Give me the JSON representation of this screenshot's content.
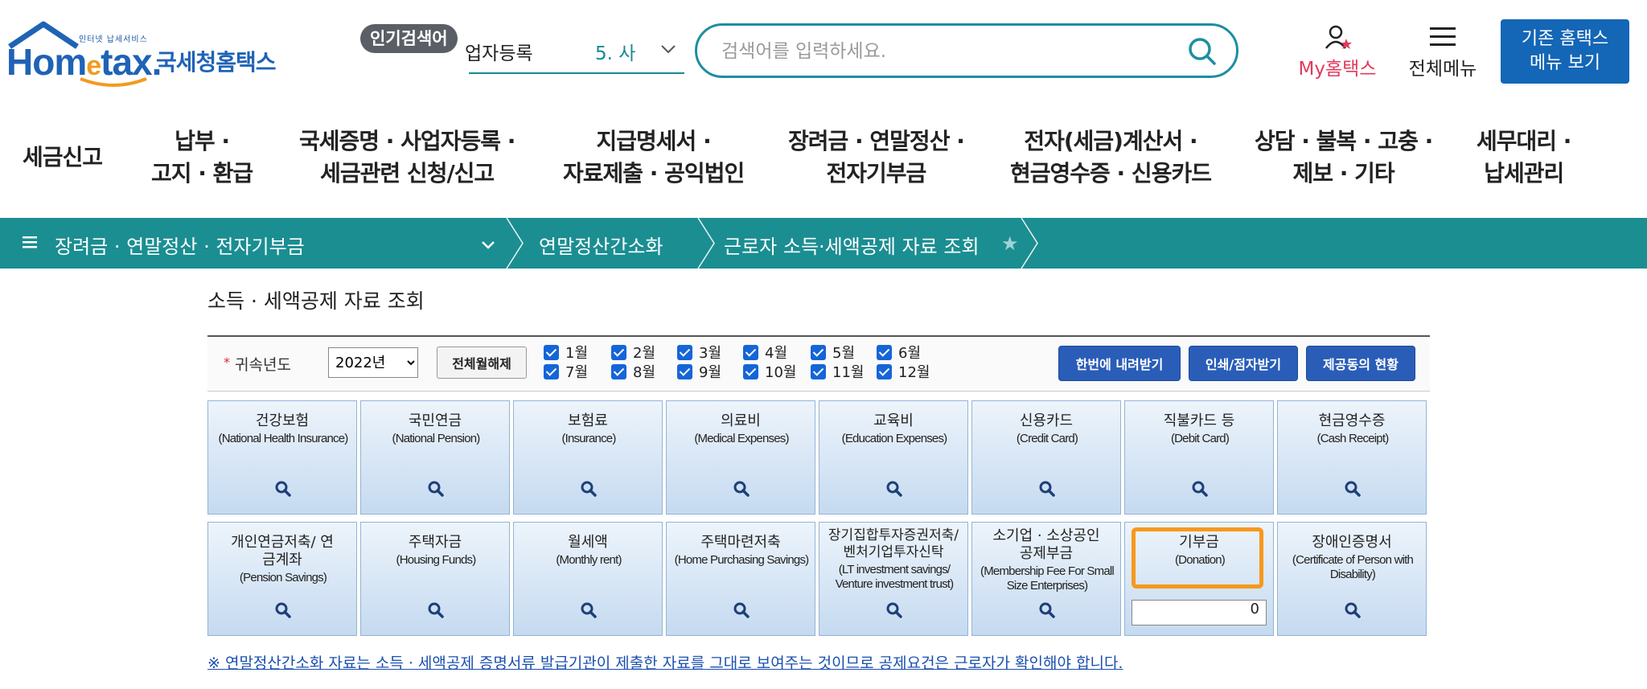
{
  "header": {
    "logo_small": "인터넷 납세서비스",
    "logo_word_a": "Hom",
    "logo_word_e": "e",
    "logo_word_b": "tax.",
    "logo_kr": "국세청홈택스",
    "popular_tag": "인기검색어",
    "popular_text": "업자등록",
    "popular_num": "5. 사",
    "search_placeholder": "검색어를 입력하세요.",
    "my_label": "My홈택스",
    "allmenu_label": "전체메뉴",
    "old_menu_line1": "기존 홈택스",
    "old_menu_line2": "메뉴 보기"
  },
  "gnb": [
    {
      "l1": "세금신고",
      "l2": ""
    },
    {
      "l1": "납부 ·",
      "l2": "고지 · 환급"
    },
    {
      "l1": "국세증명 · 사업자등록 ·",
      "l2": "세금관련 신청/신고"
    },
    {
      "l1": "지급명세서 ·",
      "l2": "자료제출 · 공익법인"
    },
    {
      "l1": "장려금 · 연말정산 ·",
      "l2": "전자기부금"
    },
    {
      "l1": "전자(세금)계산서 ·",
      "l2": "현금영수증 · 신용카드"
    },
    {
      "l1": "상담 · 불복 · 고충 ·",
      "l2": "제보 · 기타"
    },
    {
      "l1": "세무대리 ·",
      "l2": "납세관리"
    }
  ],
  "breadcrumb": {
    "level1": "장려금 · 연말정산 · 전자기부금",
    "level2": "연말정산간소화",
    "level3": "근로자 소득·세액공제 자료 조회"
  },
  "page_title": "소득 · 세액공제 자료 조회",
  "filter": {
    "year_label": "귀속년도",
    "year_value": "2022년",
    "uncheck_all": "전체월해제",
    "months": [
      "1월",
      "2월",
      "3월",
      "4월",
      "5월",
      "6월",
      "7월",
      "8월",
      "9월",
      "10월",
      "11월",
      "12월"
    ],
    "btn_download": "한번에 내려받기",
    "btn_print": "인쇄/점자받기",
    "btn_status": "제공동의 현황"
  },
  "tiles": [
    {
      "kr": "건강보험",
      "en": "(National Health Insurance)"
    },
    {
      "kr": "국민연금",
      "en": "(National Pension)"
    },
    {
      "kr": "보험료",
      "en": "(Insurance)"
    },
    {
      "kr": "의료비",
      "en": "(Medical Expenses)"
    },
    {
      "kr": "교육비",
      "en": "(Education Expenses)"
    },
    {
      "kr": "신용카드",
      "en": "(Credit Card)"
    },
    {
      "kr": "직불카드 등",
      "en": "(Debit Card)"
    },
    {
      "kr": "현금영수증",
      "en": "(Cash Receipt)"
    },
    {
      "kr": "개인연금저축/ 연금계좌",
      "en": "(Pension Savings)"
    },
    {
      "kr": "주택자금",
      "en": "(Housing Funds)"
    },
    {
      "kr": "월세액",
      "en": "(Monthly rent)"
    },
    {
      "kr": "주택마련저축",
      "en": "(Home Purchasing Savings)"
    },
    {
      "kr": "장기집합투자증권저축/ 벤처기업투자신탁",
      "en": "(LT investment savings/ Venture investment trust)"
    },
    {
      "kr": "소기업 · 소상공인 공제부금",
      "en": "(Membership Fee For Small Size Enterprises)"
    },
    {
      "kr": "기부금",
      "en": "(Donation)",
      "amount": "0"
    },
    {
      "kr": "장애인증명서",
      "en": "(Certificate of Person with Disability)"
    }
  ],
  "notice": "※ 연말정산간소화 자료는 소득 · 세액공제 증명서류 발급기관이 제출한 자료를 그대로 보여주는 것이므로 공제요건은 근로자가 확인해야 합니다.",
  "colors": {
    "teal": "#1b8e92",
    "brand_blue": "#1f63b6",
    "highlight_orange": "#f7981d",
    "button_blue": "#2a5db8"
  }
}
